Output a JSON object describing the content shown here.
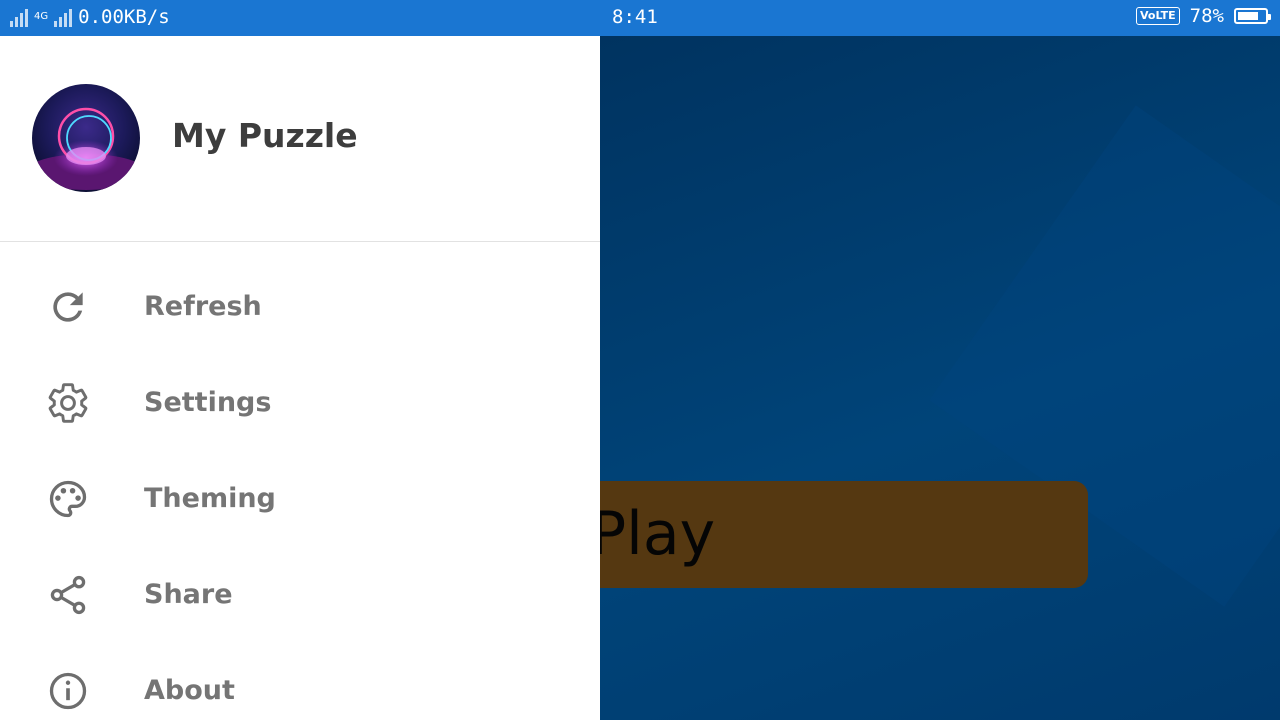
{
  "status_bar": {
    "net_type": "4G",
    "net_speed": "0.00KB/s",
    "time": "8:41",
    "volte": "VoLTE",
    "battery_percent": "78%",
    "battery_level": 78,
    "bg_color": "#1a76d2"
  },
  "drawer": {
    "app_name": "My Puzzle",
    "menu": [
      {
        "label": "Refresh",
        "icon": "refresh-icon"
      },
      {
        "label": "Settings",
        "icon": "gear-icon"
      },
      {
        "label": "Theming",
        "icon": "palette-icon"
      },
      {
        "label": "Share",
        "icon": "share-icon"
      },
      {
        "label": "About",
        "icon": "info-icon"
      }
    ]
  },
  "game": {
    "play_label": "Play",
    "play_color": "#553811",
    "bg_color": "#003a6d"
  }
}
